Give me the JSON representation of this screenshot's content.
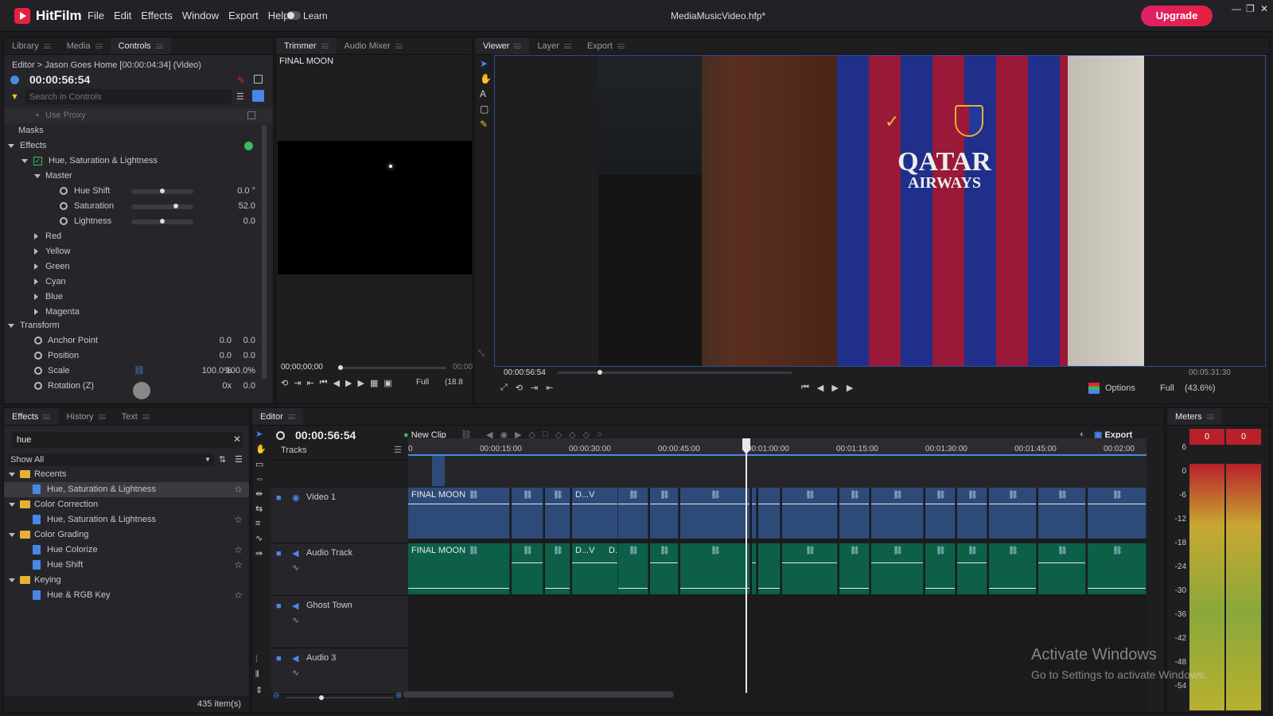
{
  "app": {
    "name": "HitFilm",
    "doc_title": "MediaMusicVideo.hfp*",
    "learn": "Learn",
    "upgrade": "Upgrade",
    "min": "—",
    "max": "❐",
    "close": "✕"
  },
  "menu": [
    "File",
    "Edit",
    "Effects",
    "Window",
    "Export",
    "Help"
  ],
  "controls_panel": {
    "tabs": [
      "Library",
      "Media",
      "Controls"
    ],
    "breadcrumb": "Editor > Jason Goes Home [00:00:04:34] (Video)",
    "timecode": "00:00:56:54",
    "search_placeholder": "Search in Controls",
    "use_proxy": "Use Proxy",
    "masks": "Masks",
    "effects": "Effects",
    "effect_name": "Hue, Saturation & Lightness",
    "master": "Master",
    "params": [
      {
        "label": "Hue Shift",
        "value": "0.0 °",
        "level": 0.5
      },
      {
        "label": "Saturation",
        "value": "52.0",
        "level": 0.73
      },
      {
        "label": "Lightness",
        "value": "0.0",
        "level": 0.5
      }
    ],
    "color_groups": [
      "Red",
      "Yellow",
      "Green",
      "Cyan",
      "Blue",
      "Magenta"
    ],
    "transform": "Transform",
    "transform_params": [
      {
        "label": "Anchor Point",
        "v1": "0.0",
        "v2": "0.0"
      },
      {
        "label": "Position",
        "v1": "0.0",
        "v2": "0.0"
      },
      {
        "label": "Scale",
        "v1": "100.0%",
        "v2": "100.0%"
      },
      {
        "label": "Rotation (Z)",
        "v1": "0x",
        "v2": "0.0"
      }
    ]
  },
  "trimmer": {
    "tabs": [
      "Trimmer",
      "Audio Mixer"
    ],
    "clip": "FINAL MOON",
    "timecode": "00;00;00;00",
    "timecode_end": "00;00",
    "quality": "Full",
    "zoom": "(18.8"
  },
  "viewer": {
    "tabs": [
      "Viewer",
      "Layer",
      "Export"
    ],
    "timecode": "00:00:56:54",
    "duration": "00:05:31:30",
    "options": "Options",
    "quality": "Full",
    "zoom": "(43.6%)",
    "scene_text": {
      "sponsor1": "QATAR",
      "sponsor2": "AIRWAYS"
    },
    "playhead": 0.17
  },
  "effects_panel": {
    "tabs": [
      "Effects",
      "History",
      "Text"
    ],
    "search_value": "hue",
    "filter": "Show All",
    "tree": [
      {
        "type": "folder",
        "label": "Recents"
      },
      {
        "type": "item",
        "label": "Hue, Saturation & Lightness",
        "selected": true
      },
      {
        "type": "folder",
        "label": "Color Correction"
      },
      {
        "type": "item",
        "label": "Hue, Saturation & Lightness"
      },
      {
        "type": "folder",
        "label": "Color Grading"
      },
      {
        "type": "item",
        "label": "Hue Colorize"
      },
      {
        "type": "item",
        "label": "Hue Shift"
      },
      {
        "type": "folder",
        "label": "Keying"
      },
      {
        "type": "item",
        "label": "Hue & RGB Key"
      }
    ],
    "count": "435 item(s)"
  },
  "editor": {
    "tab": "Editor",
    "timecode": "00:00:56:54",
    "new_clip": "New Clip",
    "export": "Export",
    "tracks_label": "Tracks",
    "ruler": [
      "0",
      "00:00:15:00",
      "00:00:30:00",
      "00:00:45:00",
      "00:01:00:00",
      "00:01:15:00",
      "00:01:30:00",
      "00:01:45:00",
      "00:02:00"
    ],
    "tracks": [
      "Video 1",
      "Audio Track",
      "Ghost Town",
      "Audio 3"
    ],
    "clip_labels": {
      "a": "FINAL MOON",
      "b": "D...V",
      "c": "D...V"
    }
  },
  "meters": {
    "tab": "Meters",
    "peaks": [
      "0",
      "0"
    ],
    "scale": [
      "6",
      "0",
      "-6",
      "-12",
      "-18",
      "-24",
      "-30",
      "-36",
      "-42",
      "-48",
      "-54"
    ]
  },
  "watermark": {
    "line1": "Activate Windows",
    "line2": "Go to Settings to activate Windows."
  },
  "colors": {
    "accent": "#4a86e8",
    "upgrade": "#e5213f",
    "video_clip": "#2e4a78",
    "audio_clip": "#0d5f48"
  }
}
